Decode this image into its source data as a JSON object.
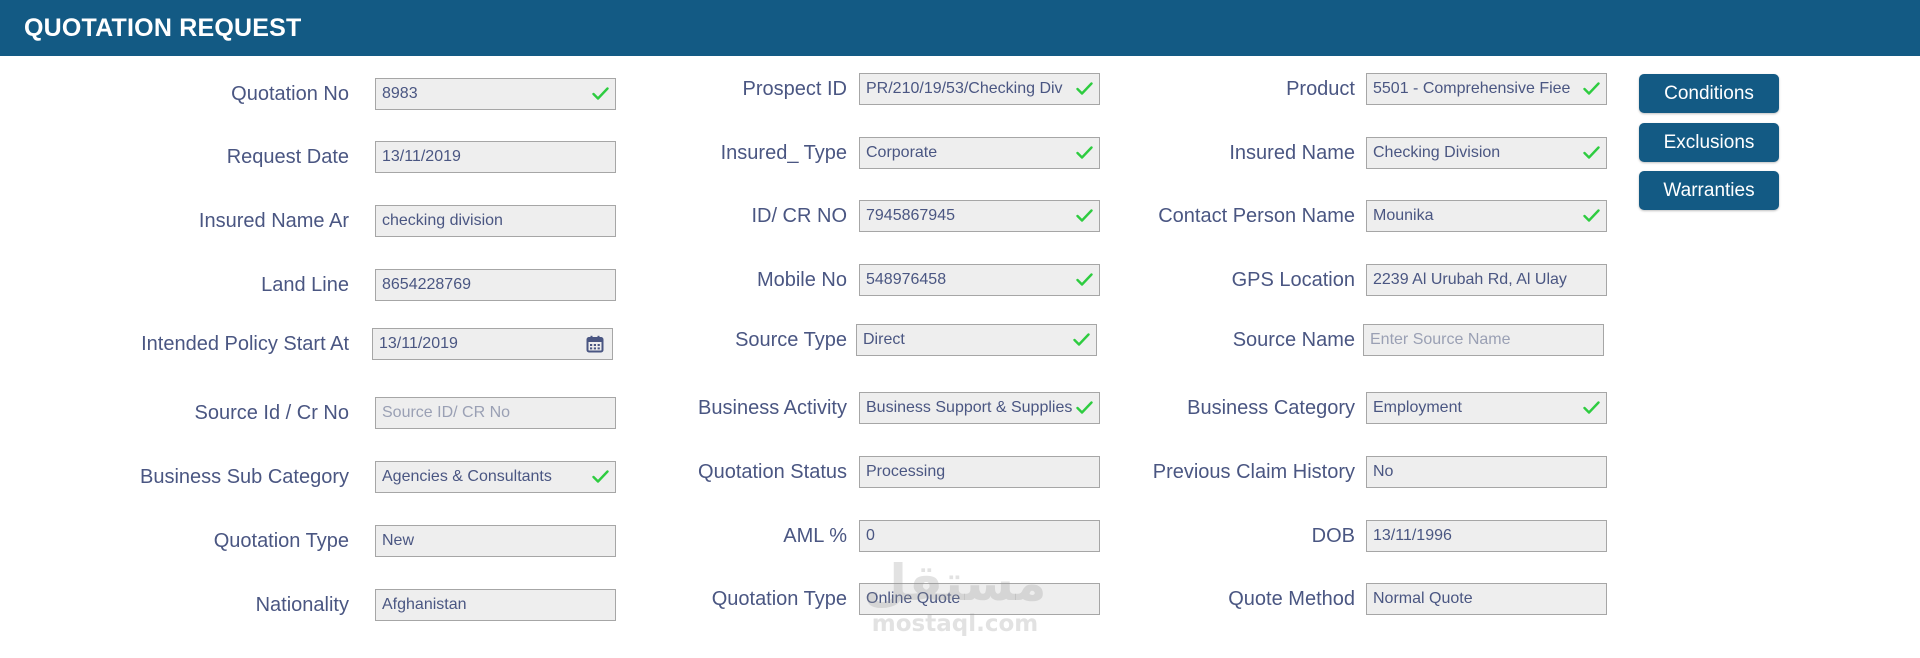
{
  "header": {
    "title": "QUOTATION REQUEST"
  },
  "buttons": {
    "conditions": "Conditions",
    "exclusions": "Exclusions",
    "warranties": "Warranties"
  },
  "col1": [
    {
      "label": "Quotation No",
      "value": "8983",
      "placeholder": "",
      "status": "check"
    },
    {
      "label": "Request Date",
      "value": "13/11/2019",
      "placeholder": "",
      "status": "none"
    },
    {
      "label": "Insured Name Ar",
      "value": "checking division",
      "placeholder": "",
      "status": "none"
    },
    {
      "label": "Land Line",
      "value": "8654228769",
      "placeholder": "",
      "status": "none"
    },
    {
      "label": "Intended Policy Start At",
      "value": "13/11/2019",
      "placeholder": "",
      "status": "calendar"
    },
    {
      "label": "Source Id / Cr No",
      "value": "",
      "placeholder": "Source ID/ CR No",
      "status": "none"
    },
    {
      "label": "Business Sub Category",
      "value": "Agencies & Consultants",
      "placeholder": "",
      "status": "check"
    },
    {
      "label": "Quotation Type",
      "value": "New",
      "placeholder": "",
      "status": "none"
    },
    {
      "label": "Nationality",
      "value": "Afghanistan",
      "placeholder": "",
      "status": "none"
    }
  ],
  "col2": [
    {
      "label": "Prospect ID",
      "value": "PR/210/19/53/Checking Div",
      "placeholder": "",
      "status": "check"
    },
    {
      "label": "Insured_ Type",
      "value": "Corporate",
      "placeholder": "",
      "status": "check"
    },
    {
      "label": "ID/ CR NO",
      "value": "7945867945",
      "placeholder": "",
      "status": "check"
    },
    {
      "label": "Mobile No",
      "value": "548976458",
      "placeholder": "",
      "status": "check"
    },
    {
      "label": "Source Type",
      "value": "Direct",
      "placeholder": "",
      "status": "check"
    },
    {
      "label": "Business Activity",
      "value": "Business Support & Supplies",
      "placeholder": "",
      "status": "check"
    },
    {
      "label": "Quotation Status",
      "value": "Processing",
      "placeholder": "",
      "status": "none"
    },
    {
      "label": "AML %",
      "value": "0",
      "placeholder": "",
      "status": "none"
    },
    {
      "label": "Quotation Type",
      "value": "Online Quote",
      "placeholder": "",
      "status": "none"
    }
  ],
  "col3": [
    {
      "label": "Product",
      "value": "5501 - Comprehensive Fiee",
      "placeholder": "",
      "status": "check"
    },
    {
      "label": "Insured Name",
      "value": "Checking Division",
      "placeholder": "",
      "status": "check"
    },
    {
      "label": "Contact Person Name",
      "value": "Mounika",
      "placeholder": "",
      "status": "check"
    },
    {
      "label": "GPS Location",
      "value": "2239 Al Urubah Rd, Al Ulay",
      "placeholder": "",
      "status": "none"
    },
    {
      "label": "Source Name",
      "value": "",
      "placeholder": "Enter Source Name",
      "status": "none"
    },
    {
      "label": "Business Category",
      "value": "Employment",
      "placeholder": "",
      "status": "check"
    },
    {
      "label": "Previous Claim History",
      "value": "No",
      "placeholder": "",
      "status": "none"
    },
    {
      "label": "DOB",
      "value": "13/11/1996",
      "placeholder": "",
      "status": "none"
    },
    {
      "label": "Quote Method",
      "value": "Normal Quote",
      "placeholder": "",
      "status": "none"
    }
  ],
  "watermark": {
    "logo": "مستقل",
    "text": "mostaql.com"
  },
  "colors": {
    "header": "#135a84",
    "label": "#4a5682",
    "check": "#2ecc40",
    "input_bg": "#eeeeee",
    "input_border": "#a6a6a6"
  },
  "icons": {
    "valid": "check-icon",
    "date": "calendar-icon"
  }
}
